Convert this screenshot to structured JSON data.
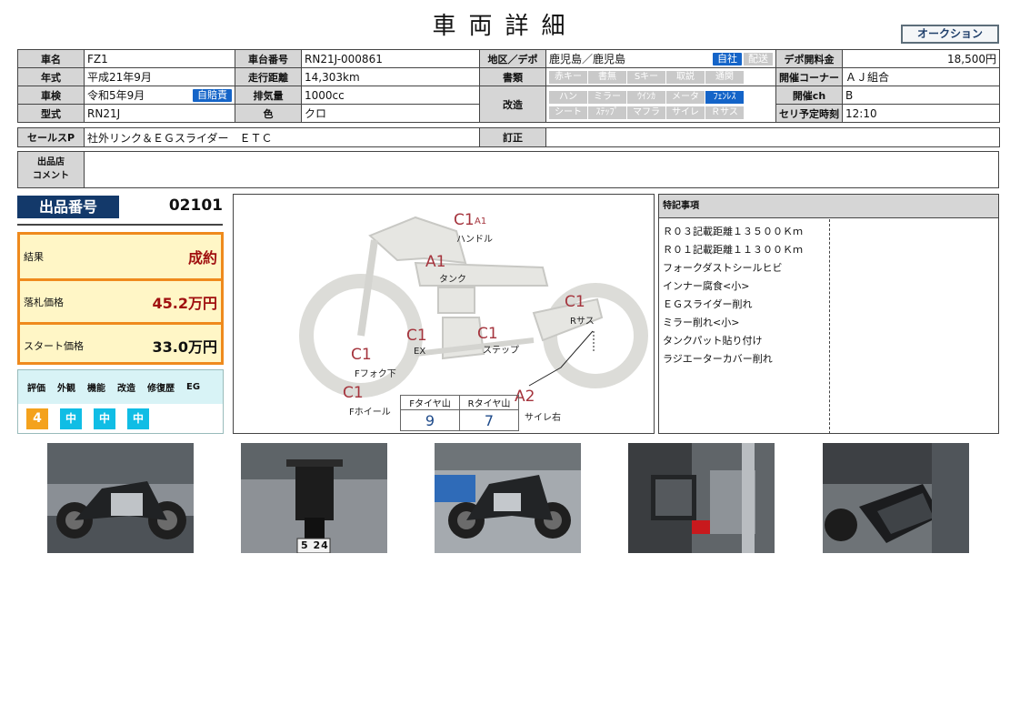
{
  "header": {
    "title": "車両詳細",
    "tag": "オークション"
  },
  "vehicle": {
    "name_label": "車名",
    "name": "FZ1",
    "frame_label": "車台番号",
    "frame": "RN21J-000861",
    "region_label": "地区／デポ",
    "region": "鹿児島／鹿児島",
    "jisha": "自社",
    "haiso": "配送",
    "fee_label": "デポ開料金",
    "fee": "18,500円",
    "year_label": "年式",
    "year": "平成21年9月",
    "mileage_label": "走行距離",
    "mileage": "14,303km",
    "docs_label": "書類",
    "corner_label": "開催コーナー",
    "corner": "ＡＪ組合",
    "inspection_label": "車検",
    "inspection": "令和5年9月",
    "insurance": "自賠責",
    "displacement_label": "排気量",
    "displacement": "1000cc",
    "mod_label": "改造",
    "channel_label": "開催ch",
    "channel": "B",
    "model_label": "型式",
    "model": "RN21J",
    "color_label": "色",
    "color": "クロ",
    "time_label": "セリ予定時刻",
    "time": "12:10",
    "docs": [
      "赤キー",
      "書無",
      "Sキー",
      "取説",
      "通関"
    ],
    "mods_row1": [
      "ハン",
      "ミラー",
      "ｳｲﾝｶ",
      "メータ",
      "ﾌｪﾝﾚｽ"
    ],
    "mods_row2": [
      "シート",
      "ｽﾃｯﾌﾟ",
      "マフラ",
      "サイレ",
      "Ｒサス"
    ]
  },
  "sale": {
    "sales_label": "セールスP",
    "sales": "社外リンク＆ＥＧスライダー　ＥＴＣ",
    "correction_label": "訂正",
    "correction": ""
  },
  "comment": {
    "label_1": "出品店",
    "label_2": "コメント",
    "text": ""
  },
  "lot": {
    "label": "出品番号",
    "number": "02101"
  },
  "result": {
    "result_label": "結果",
    "result": "成約",
    "price_label": "落札価格",
    "price": "45.2万円",
    "start_label": "スタート価格",
    "start": "33.0万円"
  },
  "grade": {
    "headers": [
      "評価",
      "外観",
      "機能",
      "改造",
      "修復歴",
      "EG"
    ],
    "values": [
      "4",
      "中",
      "中",
      "中"
    ]
  },
  "diagram": {
    "marks": [
      {
        "code": "C1",
        "sub": "A1",
        "label": "ハンドル"
      },
      {
        "code": "A1",
        "label": "タンク"
      },
      {
        "code": "C1",
        "label": "Rサス"
      },
      {
        "code": "C1",
        "label": "EX"
      },
      {
        "code": "C1",
        "label": "ステップ"
      },
      {
        "code": "C1",
        "label": "Fフォク下"
      },
      {
        "code": "C1",
        "label": "Fホイール"
      },
      {
        "code": "A2",
        "label": "サイレ右"
      }
    ],
    "tyre": {
      "front_label": "Fタイヤ山",
      "front": "9",
      "rear_label": "Rタイヤ山",
      "rear": "7"
    }
  },
  "notes": {
    "title": "特記事項",
    "items": [
      "Ｒ０３記載距離１３５００Ｋｍ",
      "Ｒ０１記載距離１１３００Ｋｍ",
      "フォークダストシールヒビ",
      "インナー腐食<小>",
      "ＥＧスライダー削れ",
      "ミラー削れ<小>",
      "タンクパット貼り付け",
      "ラジエーターカバー削れ"
    ]
  },
  "photos": {
    "plate": "5 24"
  }
}
